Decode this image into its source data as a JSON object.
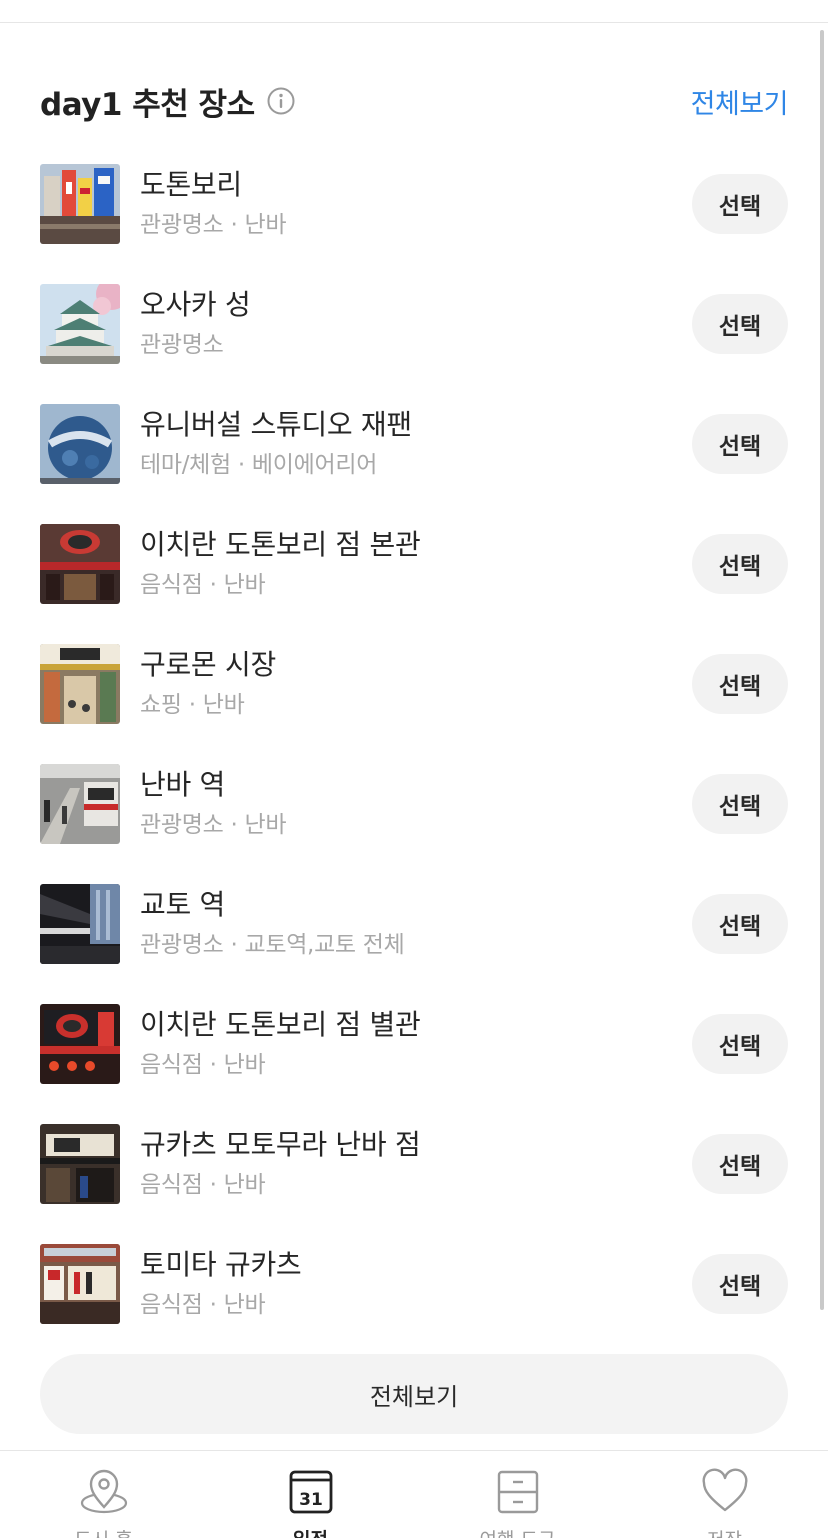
{
  "section": {
    "title": "day1 추천 장소",
    "see_all_link": "전체보기",
    "info_icon": "info-circle-icon"
  },
  "places": [
    {
      "name": "도톤보리",
      "meta": "관광명소 · 난바",
      "select_label": "선택"
    },
    {
      "name": "오사카 성",
      "meta": "관광명소",
      "select_label": "선택"
    },
    {
      "name": "유니버설 스튜디오 재팬",
      "meta": "테마/체험 · 베이에어리어",
      "select_label": "선택"
    },
    {
      "name": "이치란 도톤보리 점 본관",
      "meta": "음식점 · 난바",
      "select_label": "선택"
    },
    {
      "name": "구로몬 시장",
      "meta": "쇼핑 · 난바",
      "select_label": "선택"
    },
    {
      "name": "난바 역",
      "meta": "관광명소 · 난바",
      "select_label": "선택"
    },
    {
      "name": "교토 역",
      "meta": "관광명소 · 교토역,교토 전체",
      "select_label": "선택"
    },
    {
      "name": "이치란 도톤보리 점 별관",
      "meta": "음식점 · 난바",
      "select_label": "선택"
    },
    {
      "name": "규카츠 모토무라 난바 점",
      "meta": "음식점 · 난바",
      "select_label": "선택"
    },
    {
      "name": "토미타 규카츠",
      "meta": "음식점 · 난바",
      "select_label": "선택"
    }
  ],
  "see_all_button": "전체보기",
  "bottom_nav": [
    {
      "label": "도시 홈",
      "icon": "map-pin-icon",
      "active": false
    },
    {
      "label": "일정",
      "icon": "calendar-icon",
      "calendar_day": "31",
      "active": true
    },
    {
      "label": "여행 도구",
      "icon": "cabinet-icon",
      "active": false
    },
    {
      "label": "저장",
      "icon": "heart-icon",
      "active": false
    }
  ],
  "colors": {
    "accent": "#2f86e6",
    "meta_text": "#a8a8a8",
    "button_bg": "#f2f2f2"
  }
}
